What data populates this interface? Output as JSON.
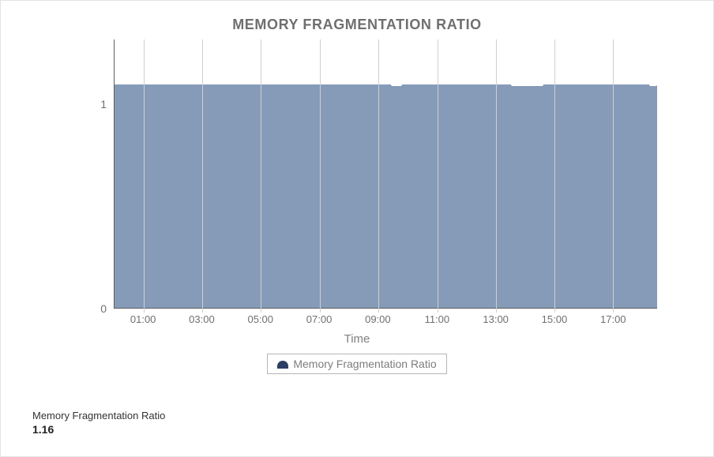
{
  "chart_title": "MEMORY FRAGMENTATION RATIO",
  "x_axis_title": "Time",
  "legend_label": "Memory Fragmentation Ratio",
  "metric_label": "Memory Fragmentation Ratio",
  "metric_value": "1.16",
  "y_ticks": [
    "0",
    "1"
  ],
  "x_ticks": [
    "01:00",
    "03:00",
    "05:00",
    "07:00",
    "09:00",
    "11:00",
    "13:00",
    "15:00",
    "17:00"
  ],
  "colors": {
    "area": "#869bb8",
    "legend_swatch": "#2d3e63"
  },
  "chart_data": {
    "type": "area",
    "title": "MEMORY FRAGMENTATION RATIO",
    "xlabel": "Time",
    "ylabel": "",
    "ylim": [
      0,
      1.4
    ],
    "series": [
      {
        "name": "Memory Fragmentation Ratio",
        "x": [
          "00:00",
          "01:00",
          "02:00",
          "03:00",
          "04:00",
          "05:00",
          "06:00",
          "07:00",
          "08:00",
          "09:00",
          "09:30",
          "10:00",
          "11:00",
          "12:00",
          "13:00",
          "13:30",
          "14:00",
          "14:30",
          "15:00",
          "16:00",
          "17:00",
          "18:00"
        ],
        "values": [
          1.17,
          1.17,
          1.17,
          1.17,
          1.17,
          1.17,
          1.17,
          1.17,
          1.17,
          1.17,
          1.16,
          1.17,
          1.17,
          1.17,
          1.17,
          1.16,
          1.16,
          1.16,
          1.17,
          1.17,
          1.17,
          1.16
        ]
      }
    ]
  }
}
